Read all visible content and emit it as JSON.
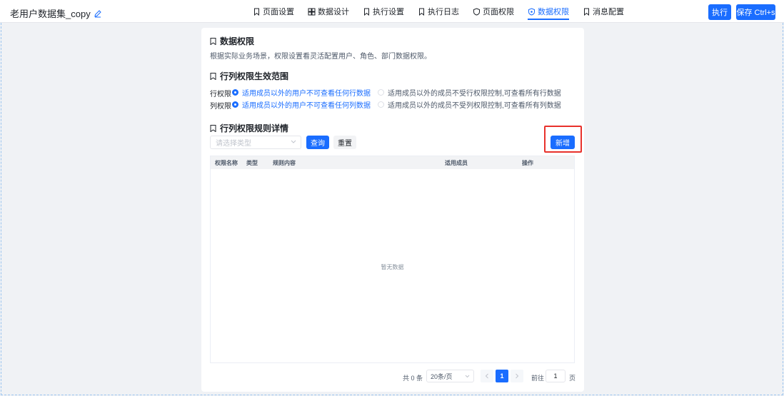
{
  "header": {
    "title": "老用户数据集_copy",
    "run_label": "执行",
    "save_label": "保存 Ctrl+s"
  },
  "nav": [
    {
      "label": "页面设置",
      "icon": "bookmark-icon",
      "active": false
    },
    {
      "label": "数据设计",
      "icon": "grid-icon",
      "active": false
    },
    {
      "label": "执行设置",
      "icon": "bookmark-icon",
      "active": false
    },
    {
      "label": "执行日志",
      "icon": "bookmark-icon",
      "active": false
    },
    {
      "label": "页面权限",
      "icon": "shield-icon",
      "active": false
    },
    {
      "label": "数据权限",
      "icon": "shield-icon",
      "active": true
    },
    {
      "label": "消息配置",
      "icon": "bookmark-icon",
      "active": false
    }
  ],
  "card": {
    "data_perm_title": "数据权限",
    "data_perm_desc": "根据实际业务场景，权限设置看灵活配置用户、角色、部门数据权限。",
    "scope_title": "行列权限生效范围",
    "row_label": "行权限",
    "row_opt1": "适用成员以外的用户不可查看任何行数据",
    "row_opt2": "适用成员以外的成员不受行权限控制,可查看所有行数据",
    "col_label": "列权限",
    "col_opt1": "适用成员以外的用户不可查看任何列数据",
    "col_opt2": "适用成员以外的成员不受列权限控制,可查看所有列数据",
    "rules_title": "行列权限规则详情",
    "select_placeholder": "请选择类型",
    "query_label": "查询",
    "reset_label": "重置",
    "add_label": "新增"
  },
  "table": {
    "columns": [
      "权限名称",
      "类型",
      "规则内容",
      "适用成员",
      "操作"
    ],
    "empty_text": "暂无数据"
  },
  "pagination": {
    "total_text": "共 0 条",
    "page_size": "20条/页",
    "current_page": "1",
    "goto_label": "前往",
    "goto_value": "1",
    "goto_unit": "页"
  },
  "colors": {
    "primary": "#1a6dff",
    "highlight": "#e8312b"
  }
}
